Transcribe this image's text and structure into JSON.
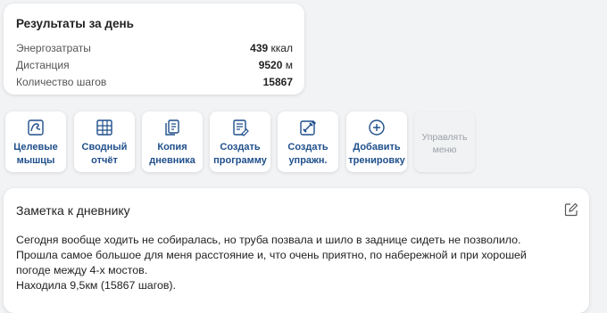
{
  "results": {
    "title": "Результаты за день",
    "rows": [
      {
        "label": "Энергозатраты",
        "value": "439",
        "unit": "ккал"
      },
      {
        "label": "Дистанция",
        "value": "9520",
        "unit": "м"
      },
      {
        "label": "Количество шагов",
        "value": "15867",
        "unit": ""
      }
    ]
  },
  "actions": [
    {
      "icon": "muscle-icon",
      "line1": "Целевые",
      "line2": "мышцы"
    },
    {
      "icon": "grid-report-icon",
      "line1": "Сводный",
      "line2": "отчёт"
    },
    {
      "icon": "copy-document-icon",
      "line1": "Копия",
      "line2": "дневника"
    },
    {
      "icon": "create-document-icon",
      "line1": "Создать",
      "line2": "программу"
    },
    {
      "icon": "exercise-edit-icon",
      "line1": "Создать",
      "line2": "упражн."
    },
    {
      "icon": "plus-circle-icon",
      "line1": "Добавить",
      "line2": "тренировку"
    },
    {
      "icon": "",
      "line1": "Управлять",
      "line2": "меню"
    }
  ],
  "note": {
    "title": "Заметка к дневнику",
    "lines": [
      "Сегодня вообще ходить не собиралась, но труба позвала и шило в заднице сидеть не позволило.",
      "Прошла самое большое для меня расстояние и, что очень приятно, по набережной и при хорошей",
      "погоде между 4-х мостов.",
      "Находила 9,5км (15867 шагов)."
    ]
  },
  "colors": {
    "accent": "#1f4f8b",
    "disabled_text": "#9aa0a6"
  }
}
